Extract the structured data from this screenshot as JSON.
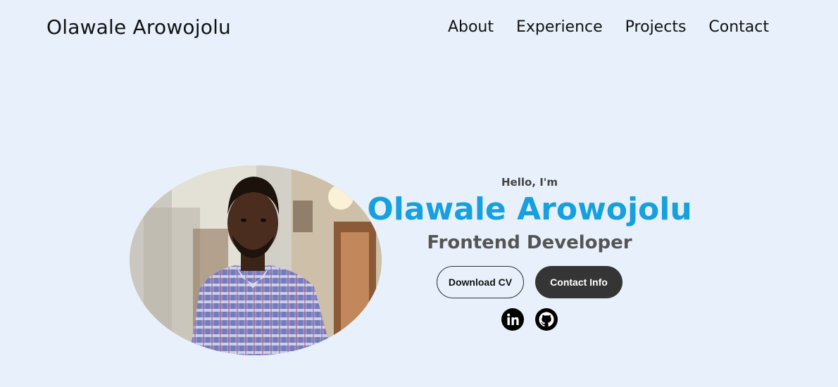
{
  "brand": {
    "name": "Olawale Arowojolu"
  },
  "nav": {
    "items": [
      {
        "label": "About"
      },
      {
        "label": "Experience"
      },
      {
        "label": "Projects"
      },
      {
        "label": "Contact"
      }
    ]
  },
  "hero": {
    "greeting": "Hello, I'm",
    "name": "Olawale Arowojolu",
    "role": "Frontend Developer",
    "download_cv_label": "Download CV",
    "contact_info_label": "Contact Info",
    "profile_pic_alt": "Profile picture",
    "socials": [
      {
        "icon": "linkedin-icon"
      },
      {
        "icon": "github-icon"
      }
    ]
  },
  "colors": {
    "background": "#e8f1fb",
    "accent": "#16a0e0",
    "button_dark": "#353535"
  }
}
